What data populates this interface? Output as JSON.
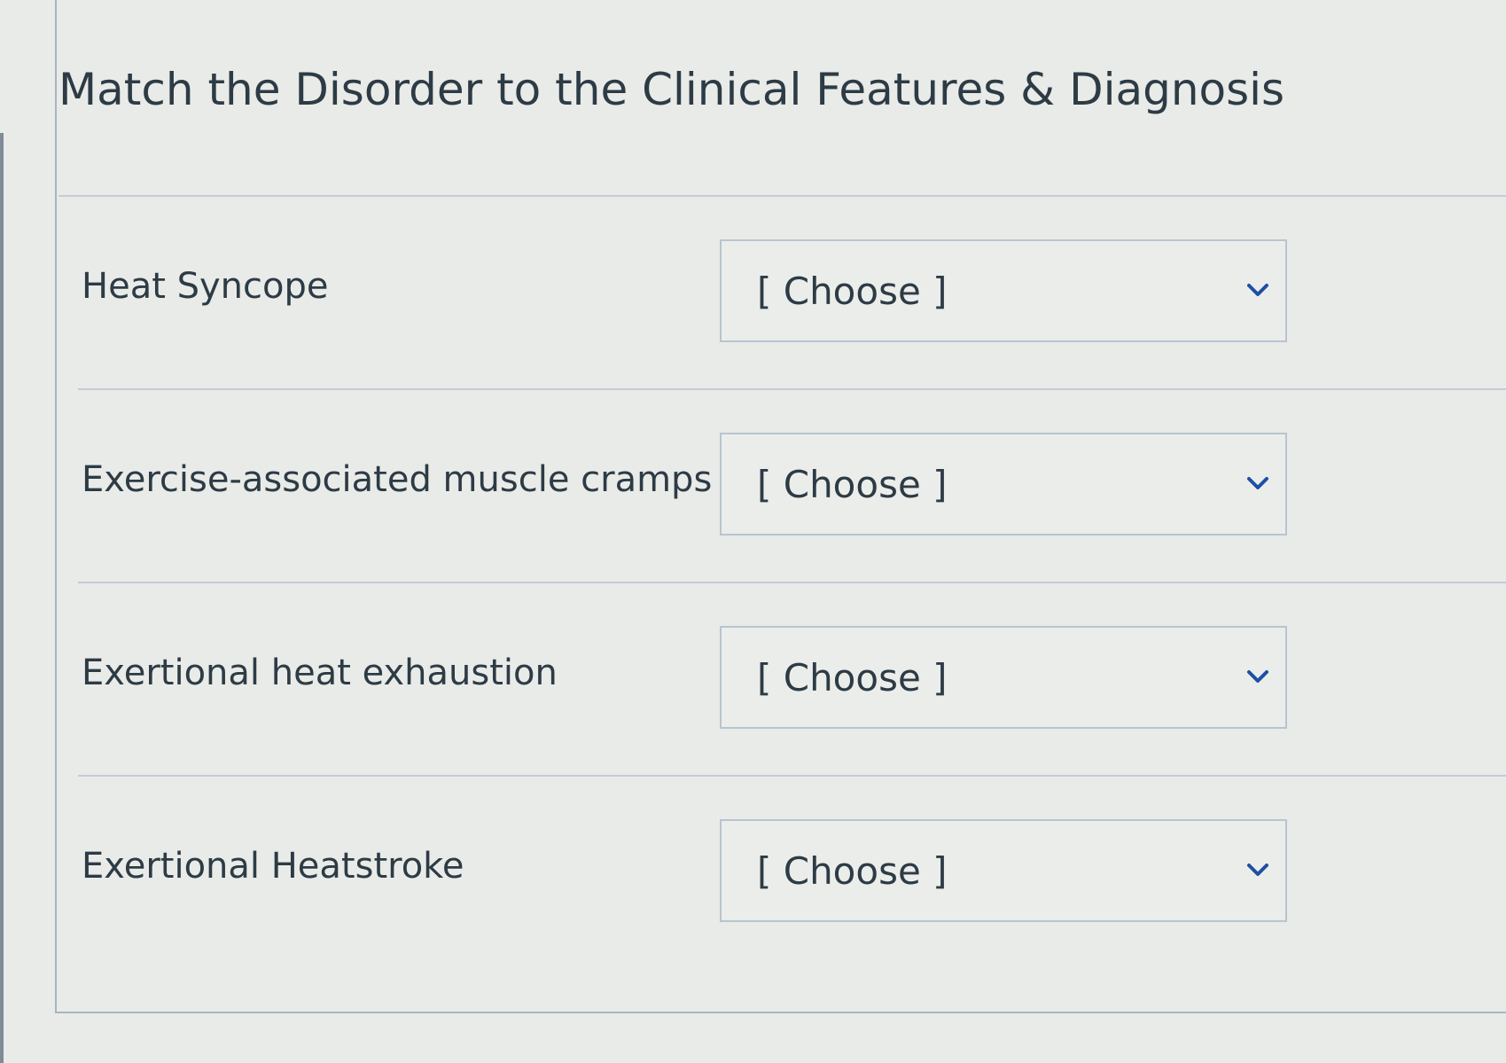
{
  "question": {
    "title": "Match the Disorder to the Clinical Features & Diagnosis"
  },
  "matches": [
    {
      "prompt": "Heat Syncope",
      "selected": "[ Choose ]"
    },
    {
      "prompt": "Exercise-associated muscle cramps",
      "selected": "[ Choose ]"
    },
    {
      "prompt": "Exertional heat exhaustion",
      "selected": "[ Choose ]"
    },
    {
      "prompt": "Exertional Heatstroke",
      "selected": "[ Choose ]"
    }
  ],
  "icons": {
    "dropdown": "chevron-down-icon"
  },
  "colors": {
    "background": "#e9ebe8",
    "text": "#2d3b45",
    "border": "#b8c4d0",
    "chevron": "#1f4fa3"
  }
}
